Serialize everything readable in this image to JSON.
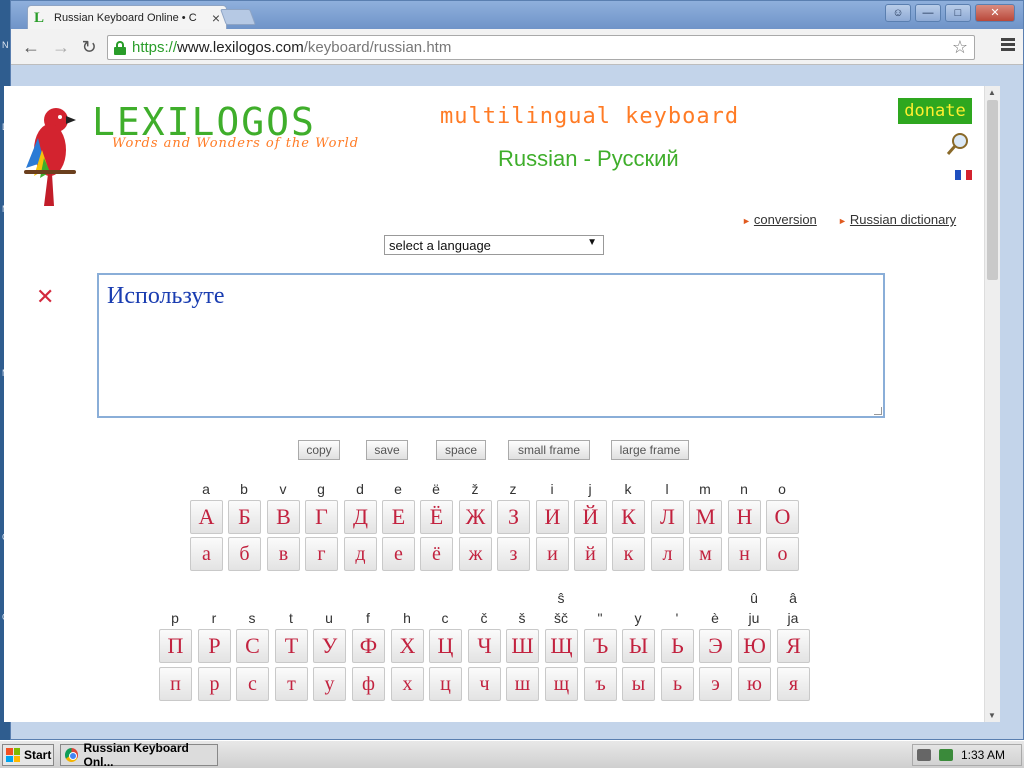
{
  "desktop": {
    "letters": [
      "N",
      "D",
      "M",
      "M",
      "C",
      "G"
    ]
  },
  "browser": {
    "tab_title": "Russian Keyboard Online • C",
    "tab_close": "×",
    "url_scheme": "https://",
    "url_host": "www.lexilogos.com",
    "url_path": "/keyboard/russian.htm",
    "window_controls": [
      "user",
      "minimize",
      "maximize",
      "close"
    ]
  },
  "site": {
    "logo": "LEXILOGOS",
    "tagline": "Words and Wonders of the World",
    "headline": "multilingual keyboard",
    "language_title": "Russian - Русский",
    "donate": "donate",
    "links": [
      "conversion",
      "Russian dictionary"
    ],
    "language_select": "select a language",
    "editor_text": "Используте",
    "actions": [
      "copy",
      "save",
      "space",
      "small frame",
      "large frame"
    ]
  },
  "keyboard": {
    "row1": {
      "translit": [
        "a",
        "b",
        "v",
        "g",
        "d",
        "e",
        "ë",
        "ž",
        "z",
        "i",
        "j",
        "k",
        "l",
        "m",
        "n",
        "o"
      ],
      "upper": [
        "А",
        "Б",
        "В",
        "Г",
        "Д",
        "Е",
        "Ё",
        "Ж",
        "З",
        "И",
        "Й",
        "К",
        "Л",
        "М",
        "Н",
        "О"
      ],
      "lower": [
        "а",
        "б",
        "в",
        "г",
        "д",
        "е",
        "ё",
        "ж",
        "з",
        "и",
        "й",
        "к",
        "л",
        "м",
        "н",
        "о"
      ]
    },
    "row2": {
      "translit_top": [
        "",
        "",
        "",
        "",
        "",
        "",
        "",
        "",
        "",
        "",
        "ŝ",
        "",
        "",
        "",
        "",
        "û",
        "â"
      ],
      "translit": [
        "p",
        "r",
        "s",
        "t",
        "u",
        "f",
        "h",
        "c",
        "č",
        "š",
        "šč",
        "ʺ",
        "y",
        "ʹ",
        "è",
        "ju",
        "ja"
      ],
      "upper": [
        "П",
        "Р",
        "С",
        "Т",
        "У",
        "Ф",
        "Х",
        "Ц",
        "Ч",
        "Ш",
        "Щ",
        "Ъ",
        "Ы",
        "Ь",
        "Э",
        "Ю",
        "Я"
      ],
      "lower": [
        "п",
        "р",
        "с",
        "т",
        "у",
        "ф",
        "х",
        "ц",
        "ч",
        "ш",
        "щ",
        "ъ",
        "ы",
        "ь",
        "э",
        "ю",
        "я"
      ]
    }
  },
  "taskbar": {
    "start": "Start",
    "task_title": "Russian Keyboard Onl...",
    "clock": "1:33 AM"
  },
  "colors": {
    "logo_green": "#3fae2b",
    "accent_orange": "#ff7b25",
    "key_text": "#c2223f",
    "editor_text": "#1a3db1"
  }
}
